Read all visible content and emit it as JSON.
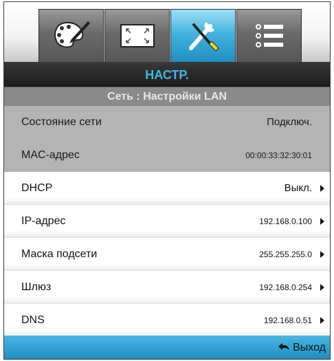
{
  "tabs": [
    {
      "icon": "palette-icon",
      "active": false
    },
    {
      "icon": "fullscreen-icon",
      "active": false
    },
    {
      "icon": "tools-icon",
      "active": true
    },
    {
      "icon": "list-menu-icon",
      "active": false
    }
  ],
  "header": {
    "title": "НАСТР.",
    "subtitle": "Сеть : Настройки LAN"
  },
  "rows": [
    {
      "label": "Состояние сети",
      "value": "Подключ.",
      "editable": false
    },
    {
      "label": "MAC-адрес",
      "value": "00:00:33:32:30:01",
      "editable": false
    },
    {
      "label": "DHCP",
      "value": "Выкл.",
      "editable": true
    },
    {
      "label": "IP-адрес",
      "value": "192.168.0.100",
      "editable": true
    },
    {
      "label": "Маска подсети",
      "value": "255.255.255.0",
      "editable": true
    },
    {
      "label": "Шлюз",
      "value": "192.168.0.254",
      "editable": true
    },
    {
      "label": "DNS",
      "value": "192.168.0.51",
      "editable": true
    }
  ],
  "footer": {
    "exit_label": "Выход",
    "exit_icon": "return-arrow-icon"
  },
  "colors": {
    "accent": "#3fb8e6",
    "footer": "#2c9fd3",
    "readonly_row": "#b4b4b4"
  }
}
